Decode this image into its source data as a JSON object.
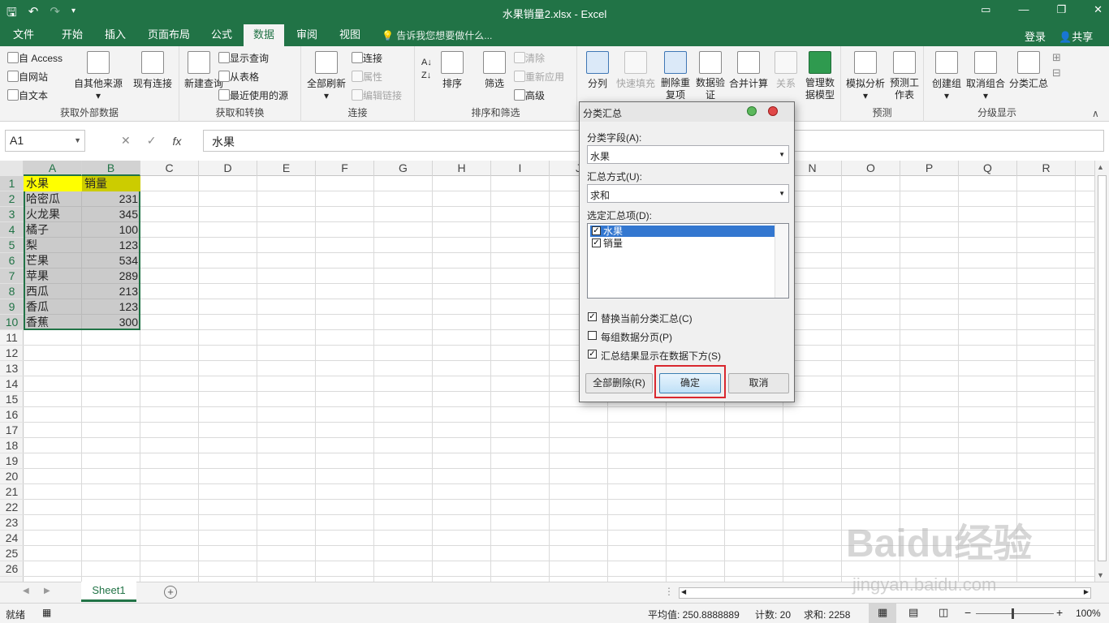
{
  "window": {
    "title": "水果销量2.xlsx - Excel"
  },
  "tabs": [
    "文件",
    "开始",
    "插入",
    "页面布局",
    "公式",
    "数据",
    "审阅",
    "视图"
  ],
  "tell_me": "告诉我您想要做什么...",
  "account": {
    "login": "登录",
    "share": "共享"
  },
  "ribbon": {
    "external": {
      "access": "自 Access",
      "web": "自网站",
      "text": "自文本",
      "other": "自其他来源",
      "existing": "现有连接",
      "label": "获取外部数据"
    },
    "transform": {
      "new_query": "新建查询",
      "show_query": "显示查询",
      "from_table": "从表格",
      "recent": "最近使用的源",
      "label": "获取和转换"
    },
    "connections": {
      "refresh_all": "全部刷新",
      "conn": "连接",
      "props": "属性",
      "edit_links": "编辑链接",
      "label": "连接"
    },
    "sort": {
      "sort": "排序",
      "filter": "筛选",
      "clear": "清除",
      "reapply": "重新应用",
      "advanced": "高级",
      "label": "排序和筛选"
    },
    "tools": {
      "split": "分列",
      "flash": "快速填充",
      "dedupe": "删除重复项",
      "validate": "数据验证",
      "consolidate": "合并计算",
      "relations": "关系",
      "model": "管理数据模型"
    },
    "forecast": {
      "whatif": "模拟分析",
      "sheet": "预测工作表",
      "label": "预测"
    },
    "outline": {
      "group": "创建组",
      "ungroup": "取消组合",
      "subtotal": "分类汇总",
      "label": "分级显示"
    }
  },
  "formula_bar": {
    "name_box": "A1",
    "fx": "fx",
    "content": "水果"
  },
  "columns": [
    "A",
    "B",
    "C",
    "D",
    "E",
    "F",
    "G",
    "H",
    "I",
    "J",
    "K",
    "L",
    "M",
    "N",
    "O",
    "P",
    "Q",
    "R"
  ],
  "rows": [
    "1",
    "2",
    "3",
    "4",
    "5",
    "6",
    "7",
    "8",
    "9",
    "10",
    "11",
    "12",
    "13",
    "14",
    "15",
    "16",
    "17",
    "18",
    "19",
    "20",
    "21",
    "22",
    "23",
    "24",
    "25",
    "26"
  ],
  "table": {
    "header": [
      "水果",
      "销量"
    ],
    "rows": [
      [
        "哈密瓜",
        "231"
      ],
      [
        "火龙果",
        "345"
      ],
      [
        "橘子",
        "100"
      ],
      [
        "梨",
        "123"
      ],
      [
        "芒果",
        "534"
      ],
      [
        "苹果",
        "289"
      ],
      [
        "西瓜",
        "213"
      ],
      [
        "香瓜",
        "123"
      ],
      [
        "香蕉",
        "300"
      ]
    ]
  },
  "sheet_tab": "Sheet1",
  "status": {
    "ready": "就绪",
    "average": "平均值: 250.8888889",
    "count": "计数: 20",
    "sum": "求和: 2258",
    "zoom": "100%"
  },
  "dialog": {
    "title": "分类汇总",
    "field_label": "分类字段(A):",
    "field_value": "水果",
    "method_label": "汇总方式(U):",
    "method_value": "求和",
    "items_label": "选定汇总项(D):",
    "items": [
      "水果",
      "销量"
    ],
    "opt_replace": "替换当前分类汇总(C)",
    "opt_pagebreak": "每组数据分页(P)",
    "opt_below": "汇总结果显示在数据下方(S)",
    "btn_remove": "全部删除(R)",
    "btn_ok": "确定",
    "btn_cancel": "取消"
  },
  "watermark": {
    "logo": "Baidu经验",
    "url": "jingyan.baidu.com"
  }
}
